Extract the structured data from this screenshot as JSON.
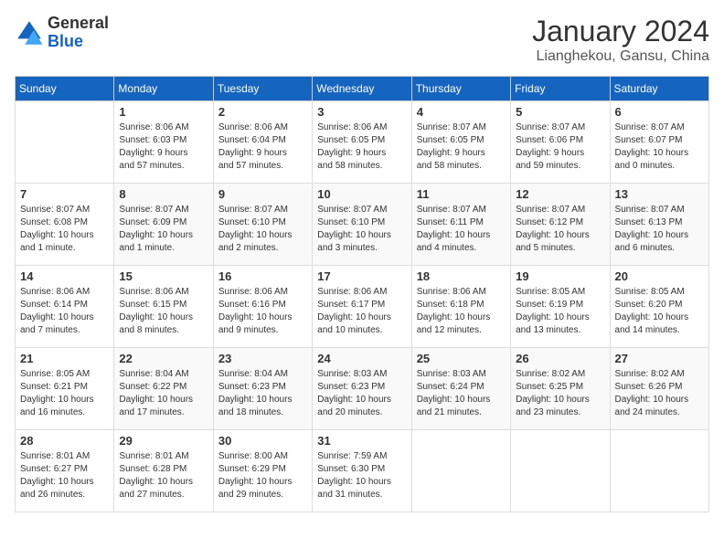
{
  "header": {
    "logo_general": "General",
    "logo_blue": "Blue",
    "month_year": "January 2024",
    "location": "Lianghekou, Gansu, China"
  },
  "days_of_week": [
    "Sunday",
    "Monday",
    "Tuesday",
    "Wednesday",
    "Thursday",
    "Friday",
    "Saturday"
  ],
  "weeks": [
    [
      {
        "day": "",
        "info": ""
      },
      {
        "day": "1",
        "info": "Sunrise: 8:06 AM\nSunset: 6:03 PM\nDaylight: 9 hours\nand 57 minutes."
      },
      {
        "day": "2",
        "info": "Sunrise: 8:06 AM\nSunset: 6:04 PM\nDaylight: 9 hours\nand 57 minutes."
      },
      {
        "day": "3",
        "info": "Sunrise: 8:06 AM\nSunset: 6:05 PM\nDaylight: 9 hours\nand 58 minutes."
      },
      {
        "day": "4",
        "info": "Sunrise: 8:07 AM\nSunset: 6:05 PM\nDaylight: 9 hours\nand 58 minutes."
      },
      {
        "day": "5",
        "info": "Sunrise: 8:07 AM\nSunset: 6:06 PM\nDaylight: 9 hours\nand 59 minutes."
      },
      {
        "day": "6",
        "info": "Sunrise: 8:07 AM\nSunset: 6:07 PM\nDaylight: 10 hours\nand 0 minutes."
      }
    ],
    [
      {
        "day": "7",
        "info": "Sunrise: 8:07 AM\nSunset: 6:08 PM\nDaylight: 10 hours\nand 1 minute."
      },
      {
        "day": "8",
        "info": "Sunrise: 8:07 AM\nSunset: 6:09 PM\nDaylight: 10 hours\nand 1 minute."
      },
      {
        "day": "9",
        "info": "Sunrise: 8:07 AM\nSunset: 6:10 PM\nDaylight: 10 hours\nand 2 minutes."
      },
      {
        "day": "10",
        "info": "Sunrise: 8:07 AM\nSunset: 6:10 PM\nDaylight: 10 hours\nand 3 minutes."
      },
      {
        "day": "11",
        "info": "Sunrise: 8:07 AM\nSunset: 6:11 PM\nDaylight: 10 hours\nand 4 minutes."
      },
      {
        "day": "12",
        "info": "Sunrise: 8:07 AM\nSunset: 6:12 PM\nDaylight: 10 hours\nand 5 minutes."
      },
      {
        "day": "13",
        "info": "Sunrise: 8:07 AM\nSunset: 6:13 PM\nDaylight: 10 hours\nand 6 minutes."
      }
    ],
    [
      {
        "day": "14",
        "info": "Sunrise: 8:06 AM\nSunset: 6:14 PM\nDaylight: 10 hours\nand 7 minutes."
      },
      {
        "day": "15",
        "info": "Sunrise: 8:06 AM\nSunset: 6:15 PM\nDaylight: 10 hours\nand 8 minutes."
      },
      {
        "day": "16",
        "info": "Sunrise: 8:06 AM\nSunset: 6:16 PM\nDaylight: 10 hours\nand 9 minutes."
      },
      {
        "day": "17",
        "info": "Sunrise: 8:06 AM\nSunset: 6:17 PM\nDaylight: 10 hours\nand 10 minutes."
      },
      {
        "day": "18",
        "info": "Sunrise: 8:06 AM\nSunset: 6:18 PM\nDaylight: 10 hours\nand 12 minutes."
      },
      {
        "day": "19",
        "info": "Sunrise: 8:05 AM\nSunset: 6:19 PM\nDaylight: 10 hours\nand 13 minutes."
      },
      {
        "day": "20",
        "info": "Sunrise: 8:05 AM\nSunset: 6:20 PM\nDaylight: 10 hours\nand 14 minutes."
      }
    ],
    [
      {
        "day": "21",
        "info": "Sunrise: 8:05 AM\nSunset: 6:21 PM\nDaylight: 10 hours\nand 16 minutes."
      },
      {
        "day": "22",
        "info": "Sunrise: 8:04 AM\nSunset: 6:22 PM\nDaylight: 10 hours\nand 17 minutes."
      },
      {
        "day": "23",
        "info": "Sunrise: 8:04 AM\nSunset: 6:23 PM\nDaylight: 10 hours\nand 18 minutes."
      },
      {
        "day": "24",
        "info": "Sunrise: 8:03 AM\nSunset: 6:23 PM\nDaylight: 10 hours\nand 20 minutes."
      },
      {
        "day": "25",
        "info": "Sunrise: 8:03 AM\nSunset: 6:24 PM\nDaylight: 10 hours\nand 21 minutes."
      },
      {
        "day": "26",
        "info": "Sunrise: 8:02 AM\nSunset: 6:25 PM\nDaylight: 10 hours\nand 23 minutes."
      },
      {
        "day": "27",
        "info": "Sunrise: 8:02 AM\nSunset: 6:26 PM\nDaylight: 10 hours\nand 24 minutes."
      }
    ],
    [
      {
        "day": "28",
        "info": "Sunrise: 8:01 AM\nSunset: 6:27 PM\nDaylight: 10 hours\nand 26 minutes."
      },
      {
        "day": "29",
        "info": "Sunrise: 8:01 AM\nSunset: 6:28 PM\nDaylight: 10 hours\nand 27 minutes."
      },
      {
        "day": "30",
        "info": "Sunrise: 8:00 AM\nSunset: 6:29 PM\nDaylight: 10 hours\nand 29 minutes."
      },
      {
        "day": "31",
        "info": "Sunrise: 7:59 AM\nSunset: 6:30 PM\nDaylight: 10 hours\nand 31 minutes."
      },
      {
        "day": "",
        "info": ""
      },
      {
        "day": "",
        "info": ""
      },
      {
        "day": "",
        "info": ""
      }
    ]
  ]
}
